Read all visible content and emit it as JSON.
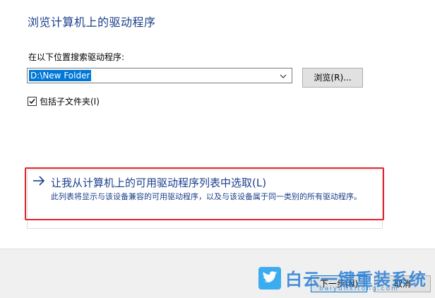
{
  "header": {
    "title": "浏览计算机上的驱动程序"
  },
  "search": {
    "label": "在以下位置搜索驱动程序:",
    "path_value": "D:\\New Folder",
    "browse_label": "浏览(R)..."
  },
  "options": {
    "include_subfolders_label": "包括子文件夹(I)",
    "include_subfolders_checked": true
  },
  "pick_option": {
    "title": "让我从计算机上的可用驱动程序列表中选取(L)",
    "description": "此列表将显示与该设备兼容的可用驱动程序，以及与该设备属于同一类别的所有驱动程序。"
  },
  "footer": {
    "next_label": "下一步(N)",
    "cancel_label": "取消"
  },
  "watermark": {
    "brand": "白云一键重装系统",
    "url": "baiyunxitong.com"
  },
  "colors": {
    "title_blue": "#1b3f8b",
    "selection_blue": "#0078d7",
    "highlight_red": "#e3232b",
    "watermark_blue": "#2a7fd4"
  }
}
